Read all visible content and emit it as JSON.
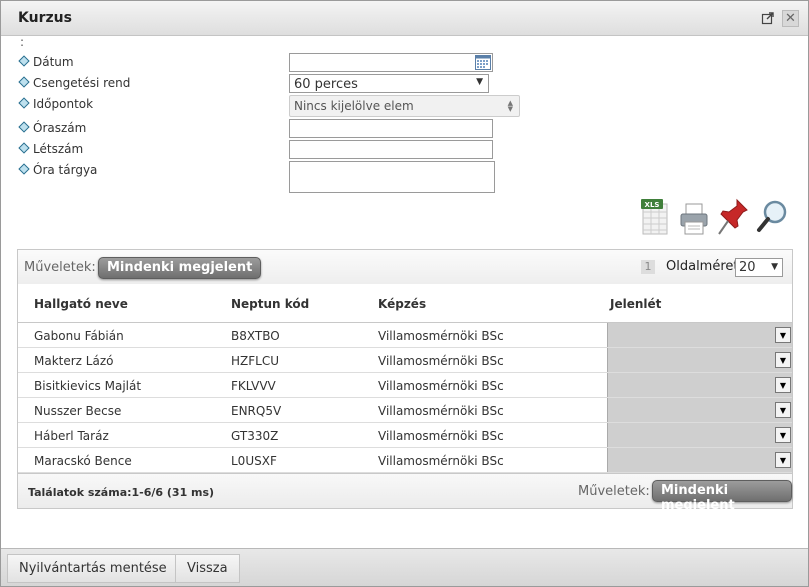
{
  "window": {
    "title": "Kurzus"
  },
  "form": {
    "dots": ":",
    "fields": [
      {
        "label": "Dátum"
      },
      {
        "label": "Csengetési rend",
        "value": "60 perces"
      },
      {
        "label": "Időpontok",
        "placeholder": "Nincs kijelölve elem"
      },
      {
        "label": "Óraszám"
      },
      {
        "label": "Létszám"
      },
      {
        "label": "Óra tárgya"
      }
    ]
  },
  "toolbar": {
    "icons": [
      "xls-export-icon",
      "print-icon",
      "pin-icon",
      "search-icon"
    ]
  },
  "grid": {
    "actions_label": "Műveletek:",
    "action_button": "Mindenki megjelent",
    "page_number": "1",
    "page_size_label": "Oldalméret",
    "page_size": "20",
    "columns": [
      "Hallgató neve",
      "Neptun kód",
      "Képzés",
      "Jelenlét"
    ],
    "rows": [
      {
        "name": "Gabonu Fábián",
        "neptun": "B8XTBO",
        "kepzes": "Villamosmérnöki BSc"
      },
      {
        "name": "Makterz Lázó",
        "neptun": "HZFLCU",
        "kepzes": "Villamosmérnöki BSc"
      },
      {
        "name": "Bisitkievics Majlát",
        "neptun": "FKLVVV",
        "kepzes": "Villamosmérnöki BSc"
      },
      {
        "name": "Nusszer Becse",
        "neptun": "ENRQ5V",
        "kepzes": "Villamosmérnöki BSc"
      },
      {
        "name": "Háberl Taráz",
        "neptun": "GT330Z",
        "kepzes": "Villamosmérnöki BSc"
      },
      {
        "name": "Maracskó Bence",
        "neptun": "L0USXF",
        "kepzes": "Villamosmérnöki BSc"
      }
    ],
    "results_label": "Találatok száma:1-6/6 (31 ms)"
  },
  "footer": {
    "save_button": "Nyilvántartás mentése",
    "back_button": "Vissza"
  },
  "colors": {
    "action_button": "#7f7f7f",
    "jelenlet_cell": "#cfcfcf"
  }
}
